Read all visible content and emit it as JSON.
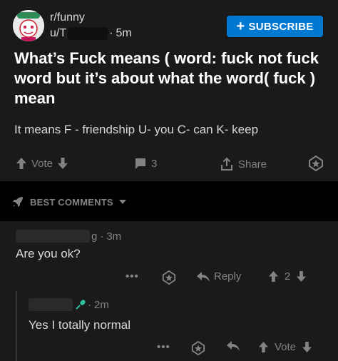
{
  "colors": {
    "background": "#000000",
    "card": "#1a1a1b",
    "subscribe_bg": "#0079d3",
    "text_primary": "#d7dadc",
    "text_muted": "#818384",
    "title": "#ffffff"
  },
  "post": {
    "subreddit": "r/funny",
    "author_prefix": "u/T",
    "time": "5m",
    "subscribe_label": "SUBSCRIBE",
    "title": "What’s Fuck means ( word: fuck not fuck word but it’s about what the word( fuck ) mean",
    "body": "It means F - friendship U- you C- can K- keep",
    "actions": {
      "vote_label": "Vote",
      "comment_count": "3",
      "share_label": "Share"
    }
  },
  "comments_header": {
    "sort_label": "BEST COMMENTS"
  },
  "comments": [
    {
      "time": "3m",
      "meta_tail": "g",
      "text": "Are you ok?",
      "actions": {
        "more": "•••",
        "reply_label": "Reply",
        "score": "2"
      }
    },
    {
      "time": "2m",
      "text": "Yes I totally normal",
      "actions": {
        "more": "•••",
        "vote_label": "Vote"
      }
    }
  ],
  "icons": {
    "avatar": "snoo-avatar-icon",
    "subscribe": "plus-icon",
    "upvote": "arrow-up-icon",
    "downvote": "arrow-down-icon",
    "comments": "comment-bubble-icon",
    "share": "share-icon",
    "award": "award-icon",
    "sort": "rocket-icon",
    "sort_dropdown": "caret-down-icon",
    "reply": "reply-arrow-icon",
    "user_badge": "microphone-icon"
  }
}
